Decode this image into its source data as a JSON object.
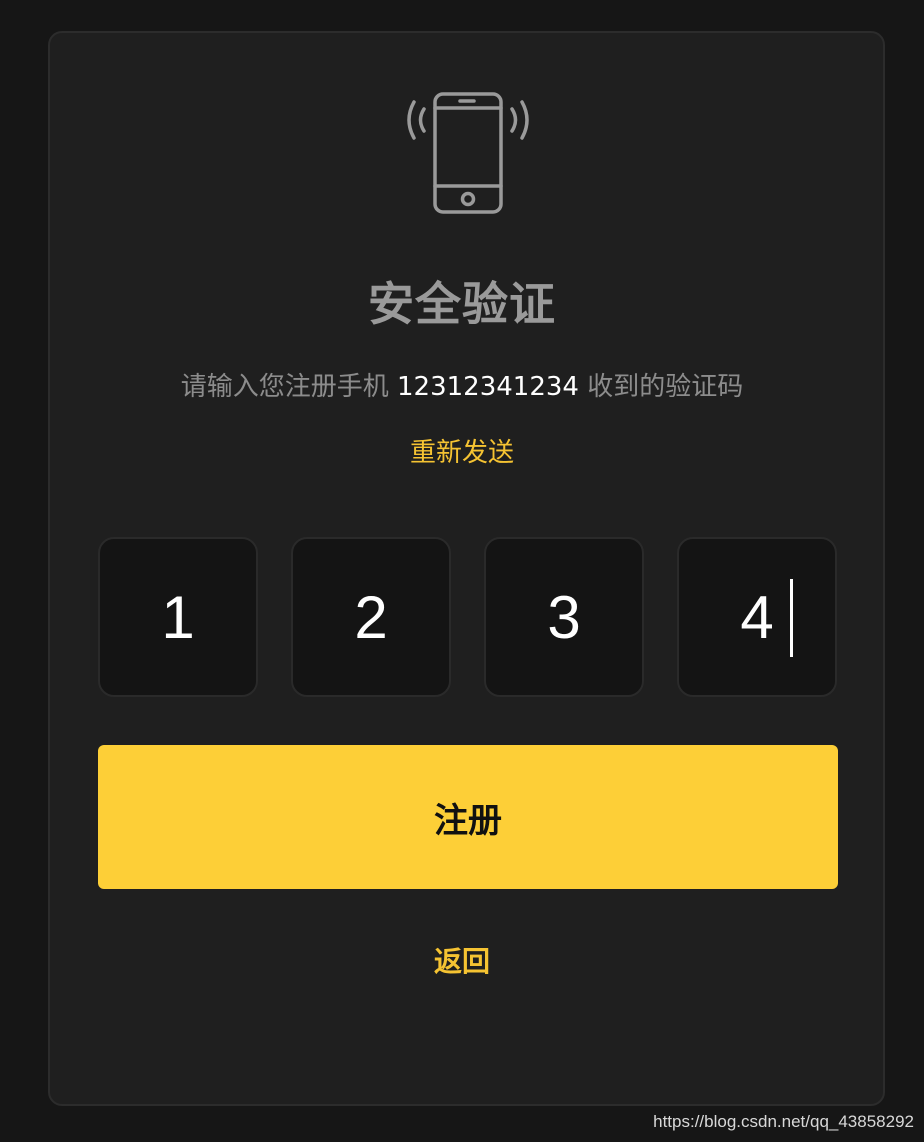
{
  "verify": {
    "title": "安全验证",
    "subtitle_prefix": "请输入您注册手机 ",
    "phone_number": "12312341234",
    "subtitle_suffix": " 收到的验证码",
    "resend_label": "重新发送",
    "code_digits": [
      "1",
      "2",
      "3",
      "4"
    ],
    "submit_label": "注册",
    "back_label": "返回"
  },
  "icons": {
    "header_icon": "vibrating-phone-icon"
  },
  "colors": {
    "accent": "#fdcf37",
    "link": "#f5c332",
    "card_background": "#1f1f1f",
    "page_background": "#161616"
  },
  "watermark": "https://blog.csdn.net/qq_43858292"
}
